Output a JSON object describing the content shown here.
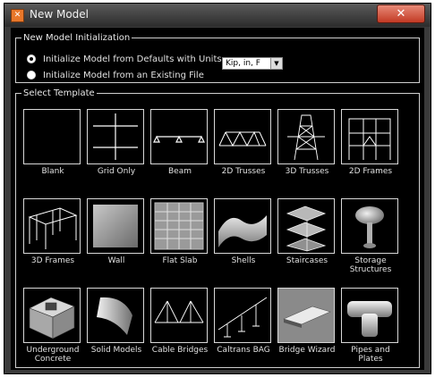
{
  "window": {
    "title": "New Model",
    "close_glyph": "✕",
    "icon": "app-icon"
  },
  "initialization": {
    "legend": "New Model Initialization",
    "option_defaults": "Initialize Model from Defaults with Units",
    "option_existing": "Initialize Model from an Existing File",
    "units_value": "Kip, in, F"
  },
  "templates": {
    "legend": "Select Template",
    "items": [
      {
        "label": "Blank",
        "icon": "blank-icon"
      },
      {
        "label": "Grid Only",
        "icon": "grid-icon"
      },
      {
        "label": "Beam",
        "icon": "beam-icon"
      },
      {
        "label": "2D Trusses",
        "icon": "truss-2d-icon"
      },
      {
        "label": "3D Trusses",
        "icon": "truss-3d-icon"
      },
      {
        "label": "2D Frames",
        "icon": "frame-2d-icon"
      },
      {
        "label": "3D Frames",
        "icon": "frame-3d-icon"
      },
      {
        "label": "Wall",
        "icon": "wall-icon"
      },
      {
        "label": "Flat Slab",
        "icon": "flat-slab-icon"
      },
      {
        "label": "Shells",
        "icon": "shell-icon"
      },
      {
        "label": "Staircases",
        "icon": "staircase-icon"
      },
      {
        "label": "Storage Structures",
        "icon": "storage-icon"
      },
      {
        "label": "Underground Concrete",
        "icon": "underground-icon"
      },
      {
        "label": "Solid Models",
        "icon": "solid-icon"
      },
      {
        "label": "Cable Bridges",
        "icon": "cable-bridge-icon"
      },
      {
        "label": "Caltrans BAG",
        "icon": "caltrans-icon"
      },
      {
        "label": "Bridge Wizard",
        "icon": "bridge-wizard-icon"
      },
      {
        "label": "Pipes and Plates",
        "icon": "pipes-icon"
      }
    ]
  }
}
